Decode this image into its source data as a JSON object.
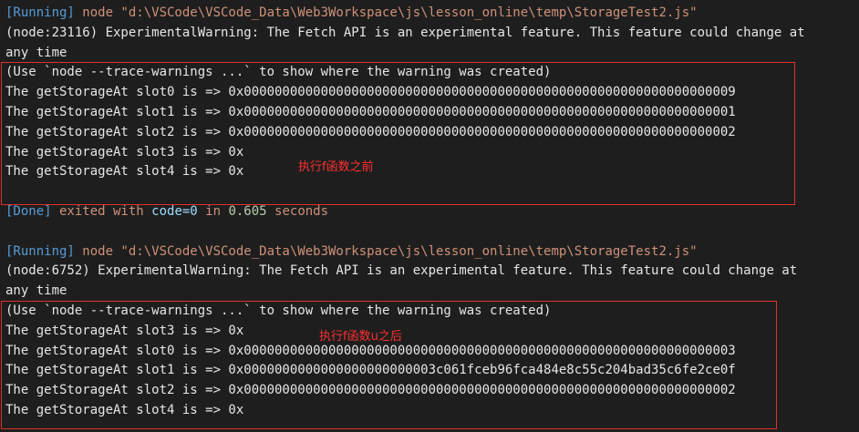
{
  "run1": {
    "running_tag": "[Running]",
    "command": " node \"d:\\VSCode\\VSCode_Data\\Web3Workspace\\js\\lesson_online\\temp\\StorageTest2.js\"",
    "warning_line1": "(node:23116) ExperimentalWarning: The Fetch API is an experimental feature. This feature could change at",
    "warning_line2": "any time",
    "trace_hint": "(Use `node --trace-warnings ...` to show where the warning was created)",
    "results": [
      "The getStorageAt slot0 is => 0x0000000000000000000000000000000000000000000000000000000000000009",
      "The getStorageAt slot1 is => 0x0000000000000000000000000000000000000000000000000000000000000001",
      "The getStorageAt slot2 is => 0x0000000000000000000000000000000000000000000000000000000000000002",
      "The getStorageAt slot3 is => 0x",
      "The getStorageAt slot4 is => 0x"
    ],
    "annotation": "执行f函数之前",
    "done_tag": "[Done]",
    "exit_text": " exited with ",
    "code_key": "code=0",
    "in_text": " in ",
    "seconds_value": "0.605",
    "seconds_text": " seconds"
  },
  "run2": {
    "running_tag": "[Running]",
    "command": " node \"d:\\VSCode\\VSCode_Data\\Web3Workspace\\js\\lesson_online\\temp\\StorageTest2.js\"",
    "warning_line1": "(node:6752) ExperimentalWarning: The Fetch API is an experimental feature. This feature could change at",
    "warning_line2": "any time",
    "trace_hint": "(Use `node --trace-warnings ...` to show where the warning was created)",
    "results": [
      "The getStorageAt slot3 is => 0x",
      "The getStorageAt slot0 is => 0x0000000000000000000000000000000000000000000000000000000000000003",
      "The getStorageAt slot1 is => 0x0000000000000000000000003c061fceb96fca484e8c55c204bad35c6fe2ce0f",
      "The getStorageAt slot2 is => 0x0000000000000000000000000000000000000000000000000000000000000002",
      "The getStorageAt slot4 is => 0x"
    ],
    "annotation": "执行f函数u之后"
  },
  "colors": {
    "background": "#1e1e1e",
    "tag": "#569cd6",
    "command": "#ce9178",
    "number": "#b5cea8",
    "annotation": "#ff3030"
  }
}
